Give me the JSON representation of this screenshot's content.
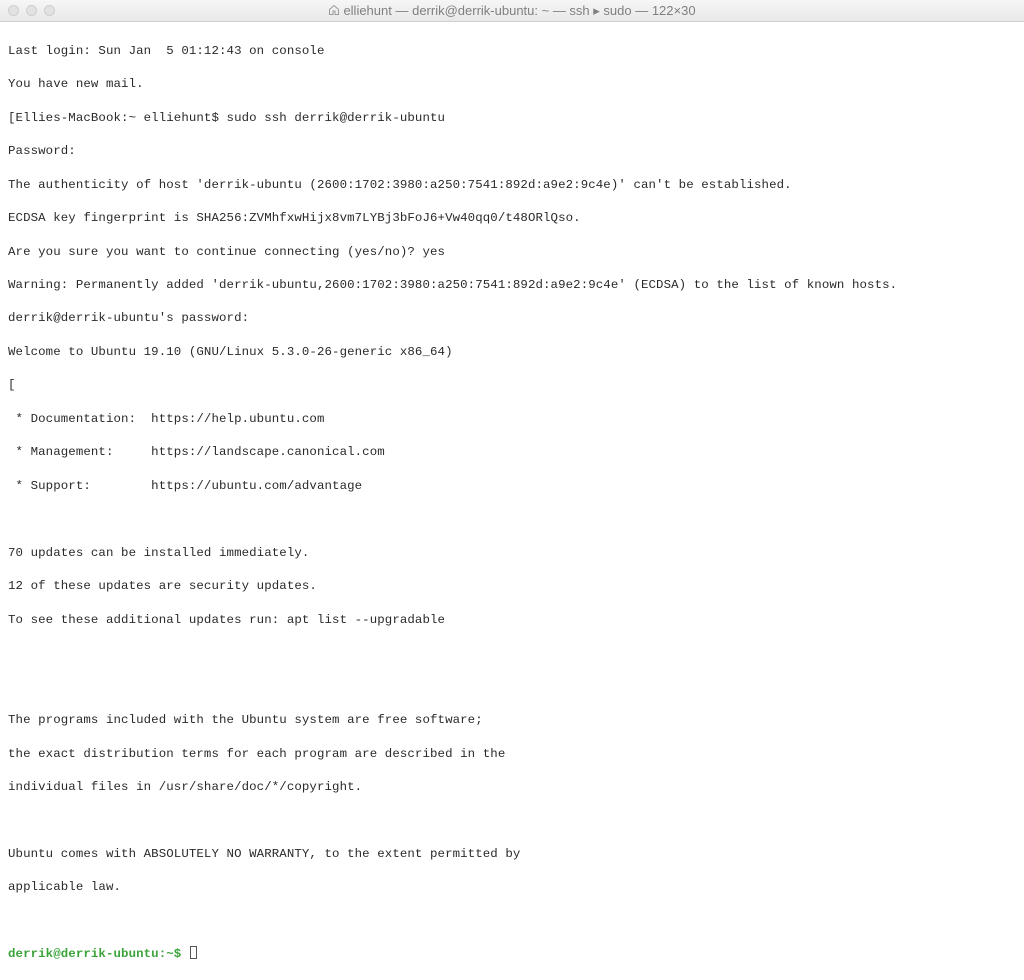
{
  "window": {
    "title": "elliehunt — derrik@derrik-ubuntu: ~ — ssh ▸ sudo — 122×30"
  },
  "terminal": {
    "last_login": "Last login: Sun Jan  5 01:12:43 on console",
    "mail_notice": "You have new mail.",
    "local_prompt_prefix": "[Ellies-MacBook:~ elliehunt$ ",
    "command": "sudo ssh derrik@derrik-ubuntu",
    "password_prompt": "Password:",
    "host_auth_warn": "The authenticity of host 'derrik-ubuntu (2600:1702:3980:a250:7541:892d:a9e2:9c4e)' can't be established.",
    "fingerprint": "ECDSA key fingerprint is SHA256:ZVMhfxwHijx8vm7LYBj3bFoJ6+Vw40qq0/t48ORlQso.",
    "confirm_prompt": "Are you sure you want to continue connecting (yes/no)? ",
    "confirm_answer": "yes",
    "added_host": "Warning: Permanently added 'derrik-ubuntu,2600:1702:3980:a250:7541:892d:a9e2:9c4e' (ECDSA) to the list of known hosts.",
    "remote_pw_prompt": "derrik@derrik-ubuntu's password:",
    "welcome": "Welcome to Ubuntu 19.10 (GNU/Linux 5.3.0-26-generic x86_64)",
    "bracket": "[",
    "doc_line": " * Documentation:  https://help.ubuntu.com",
    "mgmt_line": " * Management:     https://landscape.canonical.com",
    "support_line": " * Support:        https://ubuntu.com/advantage",
    "updates_1": "70 updates can be installed immediately.",
    "updates_2": "12 of these updates are security updates.",
    "updates_3": "To see these additional updates run: apt list --upgradable",
    "legal_1": "The programs included with the Ubuntu system are free software;",
    "legal_2": "the exact distribution terms for each program are described in the",
    "legal_3": "individual files in /usr/share/doc/*/copyright.",
    "legal_4": "Ubuntu comes with ABSOLUTELY NO WARRANTY, to the extent permitted by",
    "legal_5": "applicable law.",
    "remote_prompt": "derrik@derrik-ubuntu:~$ "
  }
}
